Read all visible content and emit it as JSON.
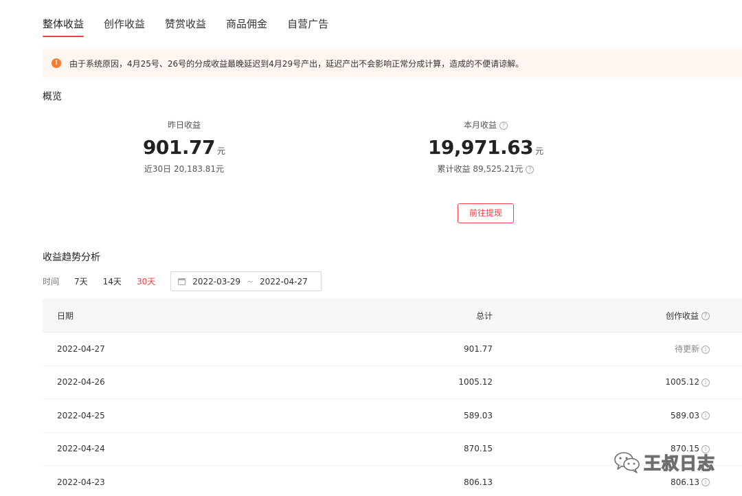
{
  "tabs": [
    {
      "label": "整体收益",
      "active": true
    },
    {
      "label": "创作收益",
      "active": false
    },
    {
      "label": "赞赏收益",
      "active": false
    },
    {
      "label": "商品佣金",
      "active": false
    },
    {
      "label": "自营广告",
      "active": false
    }
  ],
  "notice": {
    "icon": "alert-icon",
    "text": "由于系统原因，4月25号、26号的分成收益最晚延迟到4月29号产出，延迟产出不会影响正常分成计算，造成的不便请谅解。"
  },
  "overview": {
    "title": "概览",
    "yesterday": {
      "label": "昨日收益",
      "value": "901.77",
      "unit": "元",
      "sub": "近30日 20,183.81元"
    },
    "month": {
      "label": "本月收益",
      "value": "19,971.63",
      "unit": "元",
      "sub": "累计收益 89,525.21元"
    },
    "withdraw_label": "前往提现"
  },
  "trend": {
    "title": "收益趋势分析",
    "time_label": "时间",
    "ranges": [
      "7天",
      "14天",
      "30天"
    ],
    "active_range": "30天",
    "date_start": "2022-03-29",
    "date_sep": "~",
    "date_end": "2022-04-27"
  },
  "table": {
    "columns": {
      "date": "日期",
      "total": "总计",
      "creation": "创作收益"
    },
    "rows": [
      {
        "date": "2022-04-27",
        "total": "901.77",
        "creation": "待更新"
      },
      {
        "date": "2022-04-26",
        "total": "1005.12",
        "creation": "1005.12"
      },
      {
        "date": "2022-04-25",
        "total": "589.03",
        "creation": "589.03"
      },
      {
        "date": "2022-04-24",
        "total": "870.15",
        "creation": "870.15"
      },
      {
        "date": "2022-04-23",
        "total": "806.13",
        "creation": "806.13"
      }
    ]
  },
  "watermark": {
    "text": "王叔日志",
    "icon": "wechat-icon"
  },
  "colors": {
    "accent": "#f04142",
    "notice_bg": "#fff6f1",
    "notice_icon": "#ff7a2b"
  }
}
